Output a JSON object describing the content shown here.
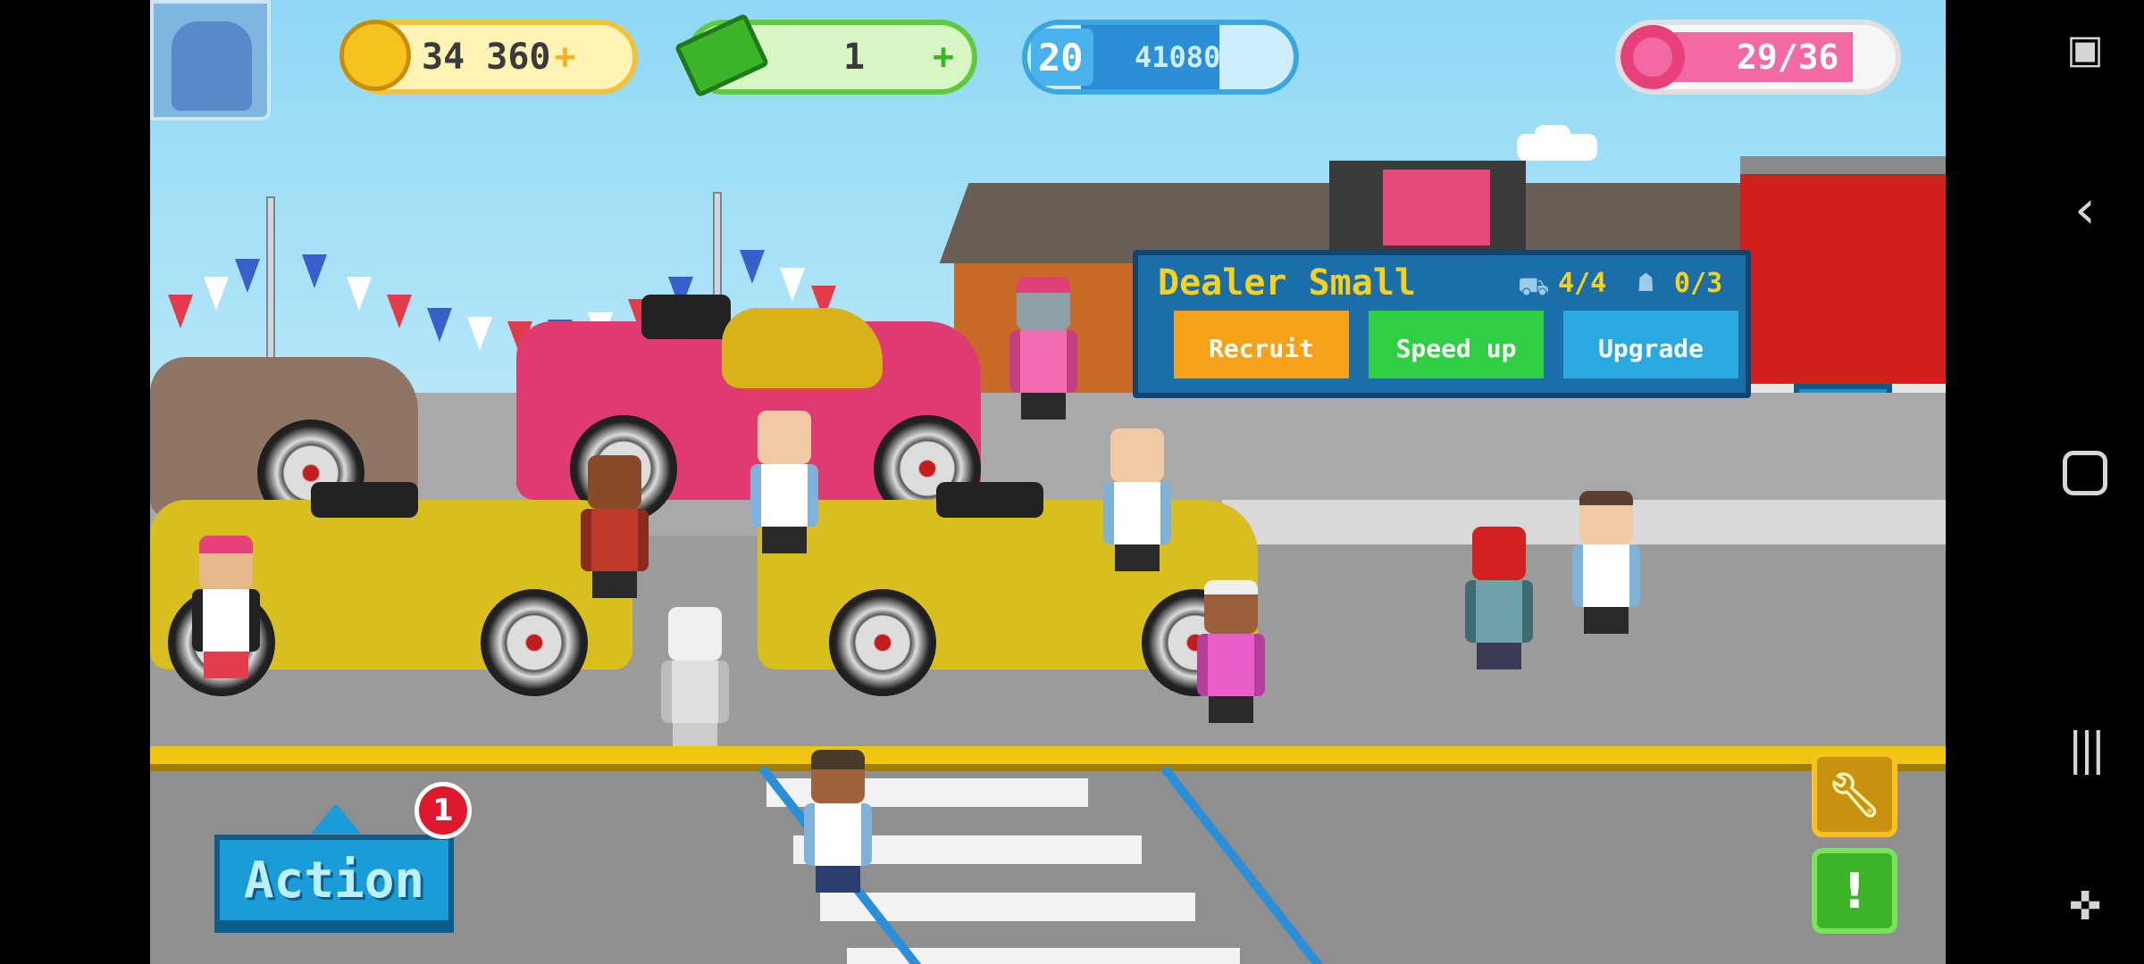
{
  "hud": {
    "coins": "34 360",
    "coins_plus": "+",
    "cash": "1",
    "cash_plus": "+",
    "level": "20",
    "xp": "41080xp",
    "xp_progress": 0.62,
    "donuts": "29/36",
    "donut_progress": 0.8
  },
  "dealer_panel": {
    "title": "Dealer Small",
    "cars": "4/4",
    "staff": "0/3",
    "buttons": {
      "recruit": "Recruit",
      "speed_up": "Speed up",
      "upgrade": "Upgrade"
    },
    "colors": {
      "recruit": "#f6a11a",
      "speed_up": "#2fcf44",
      "upgrade": "#2aa9e0"
    }
  },
  "action": {
    "label": "Action",
    "badge_count": "1"
  },
  "side_buttons": {
    "tools_icon": "wrench-icon",
    "alert_icon": "exclamation-icon"
  },
  "system_nav": {
    "icons": [
      "screenshot-icon",
      "back-icon",
      "home-icon",
      "recents-icon",
      "game-tools-icon"
    ]
  }
}
